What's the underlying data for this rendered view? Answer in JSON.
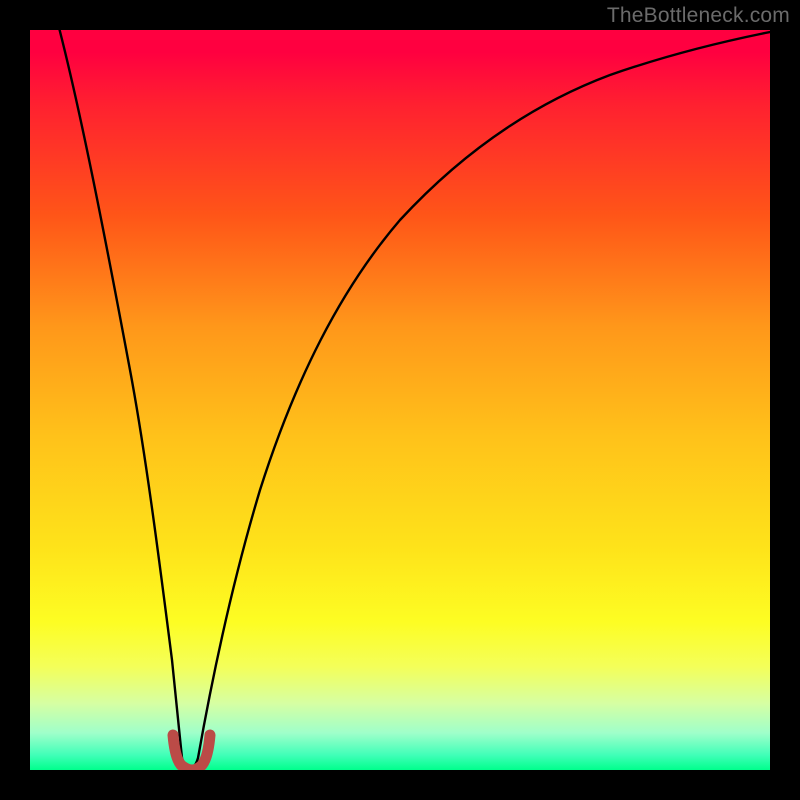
{
  "watermark": "TheBottleneck.com",
  "gradient_colors": {
    "top": "#ff0040",
    "mid_upper": "#ff971a",
    "mid": "#fee31a",
    "mid_lower": "#fdfd23",
    "bottom": "#00ff8c"
  },
  "chart_data": {
    "type": "line",
    "title": "",
    "xlabel": "",
    "ylabel": "",
    "xlim": [
      0,
      100
    ],
    "ylim": [
      0,
      100
    ],
    "series": [
      {
        "name": "bottleneck-curve",
        "color": "#000000",
        "x": [
          4,
          6,
          8,
          10,
          12,
          14,
          16,
          18,
          19,
          20,
          21,
          22,
          23,
          24,
          26,
          28,
          30,
          33,
          36,
          40,
          45,
          50,
          55,
          60,
          65,
          70,
          75,
          80,
          85,
          90,
          95,
          100
        ],
        "y": [
          100,
          87,
          75,
          63,
          52,
          41,
          30,
          15,
          7,
          1,
          0,
          1,
          7,
          16,
          30,
          41,
          49,
          57,
          63,
          70,
          76,
          81,
          84,
          87,
          90,
          92,
          94,
          95.5,
          97,
          98,
          99,
          100
        ]
      },
      {
        "name": "marker-arc",
        "color": "#bb4b47",
        "x": [
          19.3,
          19.6,
          20.0,
          20.5,
          21.0,
          21.5,
          22.0,
          22.4,
          22.7
        ],
        "y": [
          4.5,
          2.3,
          1.2,
          0.6,
          0.5,
          0.6,
          1.2,
          2.3,
          4.5
        ]
      }
    ],
    "annotations": []
  }
}
